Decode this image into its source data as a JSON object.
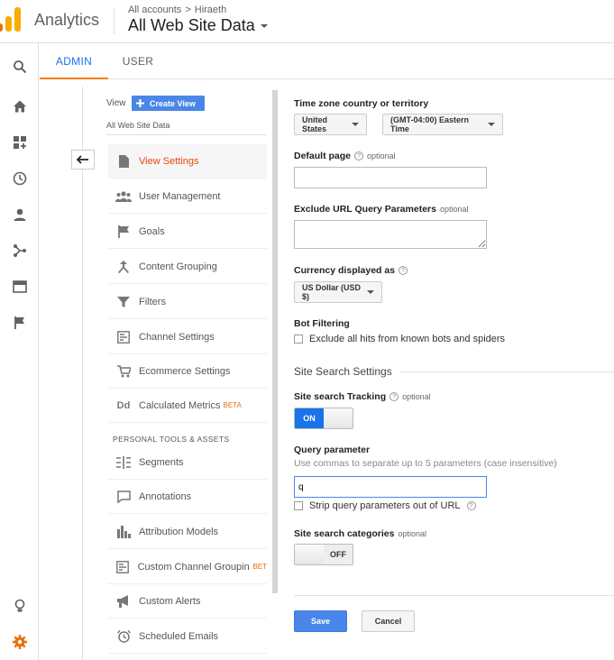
{
  "header": {
    "app_title": "Analytics",
    "breadcrumb": [
      "All accounts",
      "Hiraeth"
    ],
    "breadcrumb_sep": ">",
    "view_title": "All Web Site Data"
  },
  "tabs": {
    "admin": "ADMIN",
    "user": "USER"
  },
  "left": {
    "view_label": "View",
    "create_view": "Create View",
    "view_name": "All Web Site Data",
    "items": [
      {
        "label": "View Settings",
        "active": true
      },
      {
        "label": "User Management"
      },
      {
        "label": "Goals"
      },
      {
        "label": "Content Grouping"
      },
      {
        "label": "Filters"
      },
      {
        "label": "Channel Settings"
      },
      {
        "label": "Ecommerce Settings"
      },
      {
        "label": "Calculated Metrics",
        "badge": "BETA"
      }
    ],
    "section_header": "PERSONAL TOOLS & ASSETS",
    "tools": [
      {
        "label": "Segments"
      },
      {
        "label": "Annotations"
      },
      {
        "label": "Attribution Models"
      },
      {
        "label": "Custom Channel Grouping",
        "badge": "BET"
      },
      {
        "label": "Custom Alerts"
      },
      {
        "label": "Scheduled Emails"
      }
    ]
  },
  "form": {
    "timezone_label": "Time zone country or territory",
    "country": "United States",
    "timezone": "(GMT-04:00) Eastern Time",
    "default_page_label": "Default page",
    "optional": "optional",
    "default_page_value": "",
    "exclude_label": "Exclude URL Query Parameters",
    "exclude_value": "",
    "currency_label": "Currency displayed as",
    "currency": "US Dollar (USD $)",
    "bot_label": "Bot Filtering",
    "bot_checkbox": "Exclude all hits from known bots and spiders",
    "site_search_header": "Site Search Settings",
    "tracking_label": "Site search Tracking",
    "tracking_state": "ON",
    "query_label": "Query parameter",
    "query_hint": "Use commas to separate up to 5 parameters (case insensitive)",
    "query_value": "q",
    "strip_label": "Strip query parameters out of URL",
    "categories_label": "Site search categories",
    "categories_state": "OFF",
    "help_glyph": "?"
  },
  "buttons": {
    "save": "Save",
    "cancel": "Cancel"
  },
  "colors": {
    "accent": "#1a73e8",
    "active_nav": "#e8470b",
    "beta": "#e8710a",
    "logo_orange": "#f9ab00",
    "logo_dark": "#e37400"
  }
}
